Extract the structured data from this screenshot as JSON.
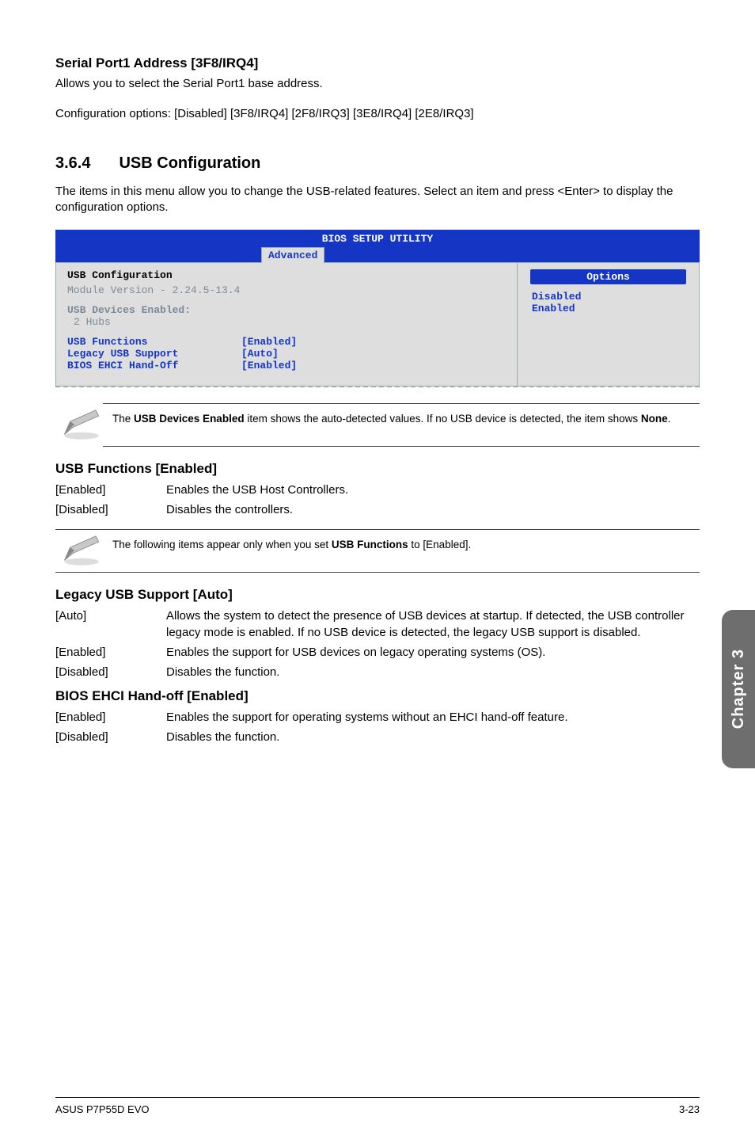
{
  "sec1": {
    "heading": "Serial Port1 Address [3F8/IRQ4]",
    "p1": "Allows you to select the Serial Port1 base address.",
    "p2": "Configuration options: [Disabled] [3F8/IRQ4] [2F8/IRQ3] [3E8/IRQ4] [2E8/IRQ3]"
  },
  "sec2": {
    "num": "3.6.4",
    "title": "USB Configuration",
    "intro": "The items in this menu allow you to change the USB-related features. Select an item and press <Enter> to display the configuration options."
  },
  "bios": {
    "title": "BIOS SETUP UTILITY",
    "tab": "Advanced",
    "cfgTitle": "USB Configuration",
    "modVer": "Module Version - 2.24.5-13.4",
    "devEnabled": "USB Devices Enabled:",
    "devSub": "2 Hubs",
    "opts": [
      {
        "name": "USB Functions",
        "val": "[Enabled]"
      },
      {
        "name": "Legacy USB Support",
        "val": "[Auto]"
      },
      {
        "name": "BIOS EHCI Hand-Off",
        "val": "[Enabled]"
      }
    ],
    "right": {
      "hdr": "Options",
      "items": [
        "Disabled",
        "Enabled"
      ]
    }
  },
  "note1": {
    "pre": "The ",
    "bold1": "USB Devices Enabled",
    "mid": " item shows the auto-detected values. If no USB device is detected, the item shows ",
    "bold2": "None",
    "post": "."
  },
  "usbFunc": {
    "heading": "USB Functions [Enabled]",
    "rows": [
      {
        "k": "[Enabled]",
        "v": "Enables the USB Host Controllers."
      },
      {
        "k": "[Disabled]",
        "v": "Disables the controllers."
      }
    ]
  },
  "note2": {
    "pre": "The following items appear only when you set ",
    "bold": "USB Functions",
    "post": " to [Enabled]."
  },
  "legacy": {
    "heading": "Legacy USB Support [Auto]",
    "rows": [
      {
        "k": "[Auto]",
        "v": "Allows the system to detect the presence of USB devices at startup. If detected, the USB controller legacy mode is enabled. If no USB device is detected, the legacy USB support is disabled."
      },
      {
        "k": "[Enabled]",
        "v": "Enables the support for USB devices on legacy operating systems (OS)."
      },
      {
        "k": "[Disabled]",
        "v": "Disables the function."
      }
    ]
  },
  "ehci": {
    "heading": "BIOS EHCI Hand-off [Enabled]",
    "rows": [
      {
        "k": "[Enabled]",
        "v": "Enables the support for operating systems without an EHCI hand-off feature."
      },
      {
        "k": "[Disabled]",
        "v": "Disables the function."
      }
    ]
  },
  "sideTab": "Chapter 3",
  "footer": {
    "left": "ASUS P7P55D EVO",
    "right": "3-23"
  }
}
